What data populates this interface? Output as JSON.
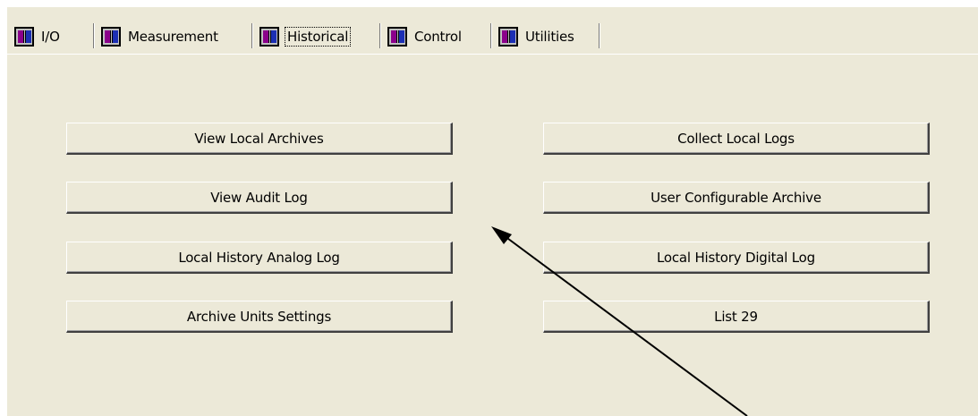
{
  "tabs": [
    {
      "label": "I/O",
      "icon": "module-icon",
      "active": false
    },
    {
      "label": "Measurement",
      "icon": "module-icon",
      "active": false
    },
    {
      "label": "Historical",
      "icon": "module-icon",
      "active": true
    },
    {
      "label": "Control",
      "icon": "module-icon",
      "active": false
    },
    {
      "label": "Utilities",
      "icon": "module-icon",
      "active": false
    }
  ],
  "buttons": {
    "view_local_archives": "View Local Archives",
    "collect_local_logs": "Collect Local Logs",
    "view_audit_log": "View Audit Log",
    "user_configurable_archive": "User Configurable Archive",
    "local_history_analog_log": "Local History Analog Log",
    "local_history_digital_log": "Local History Digital Log",
    "archive_units_settings": "Archive Units Settings",
    "list_29": "List 29"
  },
  "colors": {
    "panel_background": "#ece9d8",
    "annotation_arrow": "#000000"
  }
}
